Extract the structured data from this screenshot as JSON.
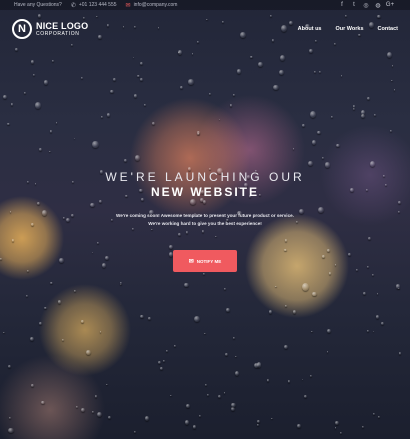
{
  "topbar": {
    "question": "Have any Questions?",
    "phone": "+01 123 444 555",
    "email": "info@company.com",
    "social_icons": [
      "facebook-icon",
      "twitter-icon",
      "instagram-icon",
      "dribbble-icon",
      "google-plus-icon"
    ]
  },
  "logo": {
    "mark": "N",
    "line1": "NICE LOGO",
    "line2": "CORPORATION"
  },
  "nav": {
    "items": [
      "About us",
      "Our Works",
      "Contact"
    ]
  },
  "hero": {
    "title_light": "WE'RE LAUNCHING OUR",
    "title_bold": "NEW WEBSITE",
    "subtitle_line1": "We're coming soon! Awesome template to present your future product or service.",
    "subtitle_line2": "We're working hard to give you the best experience!",
    "cta_label": "NOTIFY ME"
  },
  "colors": {
    "accent": "#f05a5f",
    "topbar": "#14161f"
  }
}
